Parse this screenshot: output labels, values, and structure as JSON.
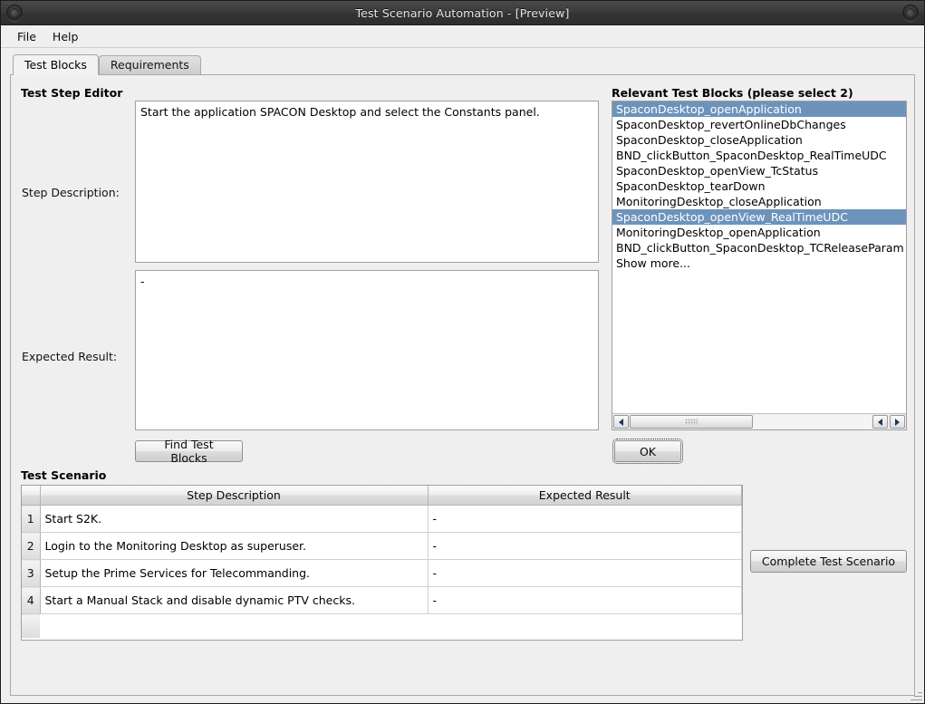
{
  "window": {
    "title": "Test Scenario Automation - [Preview]",
    "left_orb_icon": "circle-button-icon",
    "right_orb_icon": "circle-button-icon"
  },
  "menubar": {
    "items": [
      {
        "label": "File"
      },
      {
        "label": "Help"
      }
    ]
  },
  "tabs": [
    {
      "label": "Test Blocks",
      "active": true
    },
    {
      "label": "Requirements",
      "active": false
    }
  ],
  "editor": {
    "section_title": "Test Step Editor",
    "step_description_label": "Step Description:",
    "step_description_value": "Start the application SPACON Desktop and select the Constants panel.",
    "expected_result_label": "Expected Result:",
    "expected_result_value": "-",
    "find_test_blocks_label": "Find Test Blocks"
  },
  "relevant": {
    "section_title": "Relevant Test Blocks (please select 2)",
    "items": [
      {
        "label": "SpaconDesktop_openApplication",
        "selected": true
      },
      {
        "label": "SpaconDesktop_revertOnlineDbChanges",
        "selected": false
      },
      {
        "label": "SpaconDesktop_closeApplication",
        "selected": false
      },
      {
        "label": "BND_clickButton_SpaconDesktop_RealTimeUDC",
        "selected": false
      },
      {
        "label": "SpaconDesktop_openView_TcStatus",
        "selected": false
      },
      {
        "label": "SpaconDesktop_tearDown",
        "selected": false
      },
      {
        "label": "MonitoringDesktop_closeApplication",
        "selected": false
      },
      {
        "label": "SpaconDesktop_openView_RealTimeUDC",
        "selected": true
      },
      {
        "label": "MonitoringDesktop_openApplication",
        "selected": false
      },
      {
        "label": "BND_clickButton_SpaconDesktop_TCReleaseParam",
        "selected": false
      },
      {
        "label": "Show more...",
        "selected": false
      }
    ],
    "ok_label": "OK",
    "scroll_left_icon": "arrow-left-icon",
    "scroll_right_icon": "arrow-right-icon",
    "selection_color": "#6d93bb"
  },
  "scenario": {
    "section_title": "Test Scenario",
    "columns": [
      "",
      "Step Description",
      "Expected Result"
    ],
    "rows": [
      {
        "num": "1",
        "step": "Start S2K.",
        "expected": "-"
      },
      {
        "num": "2",
        "step": "Login to the Monitoring Desktop as superuser.",
        "expected": "-"
      },
      {
        "num": "3",
        "step": "Setup the Prime Services for Telecommanding.",
        "expected": "-"
      },
      {
        "num": "4",
        "step": "Start a Manual Stack and disable dynamic PTV checks.",
        "expected": "-"
      }
    ],
    "complete_button_label": "Complete Test Scenario"
  }
}
